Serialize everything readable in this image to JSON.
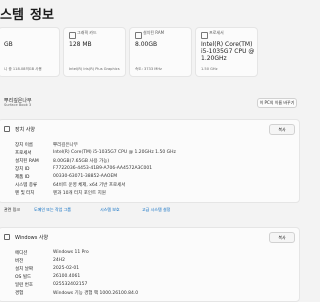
{
  "header": {
    "title_partial": "스템",
    "chevron": "›",
    "page": "정보"
  },
  "cards": [
    {
      "label": "",
      "value": "GB",
      "sub": "니 중 118.08의GB 사용"
    },
    {
      "label": "그래픽 카드",
      "value": "128 MB",
      "sub": "Intel(R) Iris(R) Plus Graphics"
    },
    {
      "label": "설치된 RAM",
      "value": "8.00GB",
      "sub": "속도: 3733 MHz"
    },
    {
      "label": "프로세서",
      "value": "Intel(R) Core(TM) i5-1035G7 CPU @ 1.20GHz",
      "sub": "1.50 GHz"
    }
  ],
  "device": {
    "name": "뿌리깊은나무",
    "model": "Surface Book 3",
    "rename_button": "이 PC의 이름 바꾸기"
  },
  "device_specs": {
    "title": "장치 사양",
    "copy_label": "복사",
    "rows": [
      {
        "key": "장치 이름",
        "value": "뿌리깊은나무"
      },
      {
        "key": "프로세서",
        "value": "Intel(R) Core(TM) i5-1035G7 CPU @ 1.20GHz   1.50 GHz"
      },
      {
        "key": "설치된 RAM",
        "value": "8.00GB(7.65GB 사용 가능)"
      },
      {
        "key": "장치 ID",
        "value": "F7722036-4453-41B9-A706-AA4572A3C001"
      },
      {
        "key": "제품 ID",
        "value": "00330-63071-38852-AAOEM"
      },
      {
        "key": "시스템 종류",
        "value": "64비트 운영 체제, x64 기반 프로세서"
      },
      {
        "key": "펜 및 터치",
        "value": "펜과 10개 터치 포인트 지원"
      }
    ]
  },
  "related_links": {
    "label": "관련 링크",
    "links": [
      "도메인 또는 작업 그룹",
      "시스템 보호",
      "고급 시스템 설정"
    ]
  },
  "windows_specs": {
    "title": "Windows 사양",
    "copy_label": "복사",
    "rows": [
      {
        "key": "에디션",
        "value": "Windows 11 Pro"
      },
      {
        "key": "버전",
        "value": "24H2"
      },
      {
        "key": "설치 날짜",
        "value": "2025-02-01"
      },
      {
        "key": "OS 빌드",
        "value": "26100.4061"
      },
      {
        "key": "일련 번호",
        "value": "025532402157"
      },
      {
        "key": "경험",
        "value": "Windows 기능 경험 팩 1000.26100.84.0"
      }
    ]
  }
}
